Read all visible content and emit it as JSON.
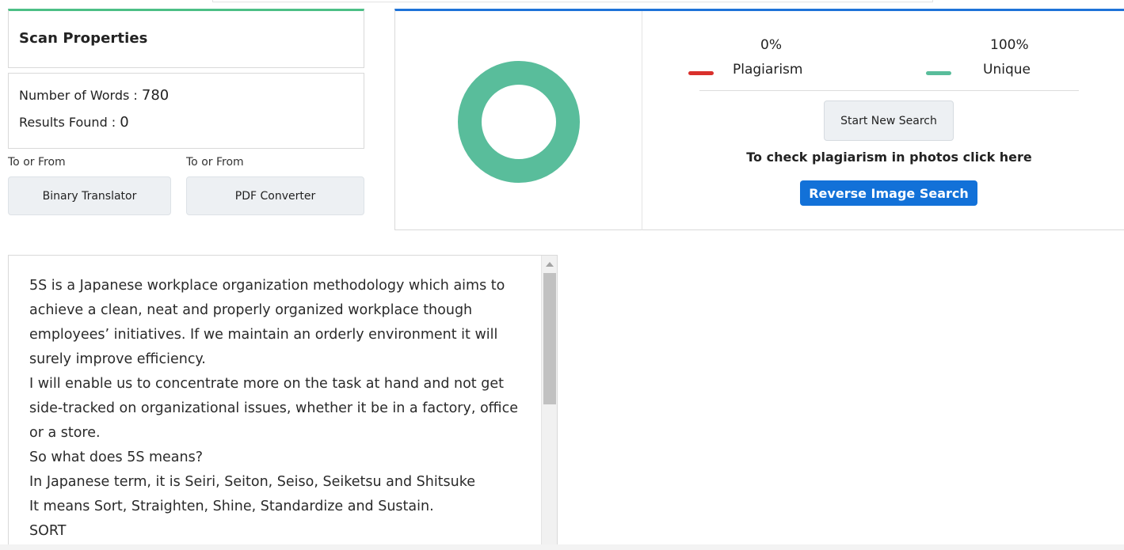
{
  "scan_properties": {
    "title": "Scan Properties",
    "words_label": "Number of Words :",
    "words_value": "780",
    "results_label": "Results Found :",
    "results_value": "0"
  },
  "tools": [
    {
      "caption": "To or From",
      "button_label": "Binary Translator"
    },
    {
      "caption": "To or From",
      "button_label": "PDF Converter"
    }
  ],
  "result": {
    "plagiarism_percent": "0%",
    "plagiarism_label": "Plagiarism",
    "unique_percent": "100%",
    "unique_label": "Unique",
    "plagiarism_fraction": 0,
    "unique_fraction": 1,
    "start_button": "Start New Search",
    "photo_prompt": "To check plagiarism in photos click here",
    "reverse_button": "Reverse Image Search"
  },
  "colors": {
    "plagiarism": "#d9302c",
    "unique": "#59bd9b",
    "accent_blue": "#1271d8",
    "accent_green": "#4cbf86"
  },
  "text_lines": [
    "5S is a Japanese workplace organization methodology which aims to",
    "achieve a clean, neat and properly organized workplace though",
    "employees’ initiatives. If we maintain an orderly environment it will",
    "surely improve efficiency.",
    "I will enable us to concentrate more on the task at hand and not get",
    "side-tracked on organizational issues, whether it be in a factory, office",
    "or a store.",
    "So what does 5S means?",
    "In Japanese term, it is Seiri, Seiton, Seiso, Seiketsu and Shitsuke",
    "It means Sort, Straighten, Shine, Standardize and Sustain.",
    "SORT"
  ]
}
